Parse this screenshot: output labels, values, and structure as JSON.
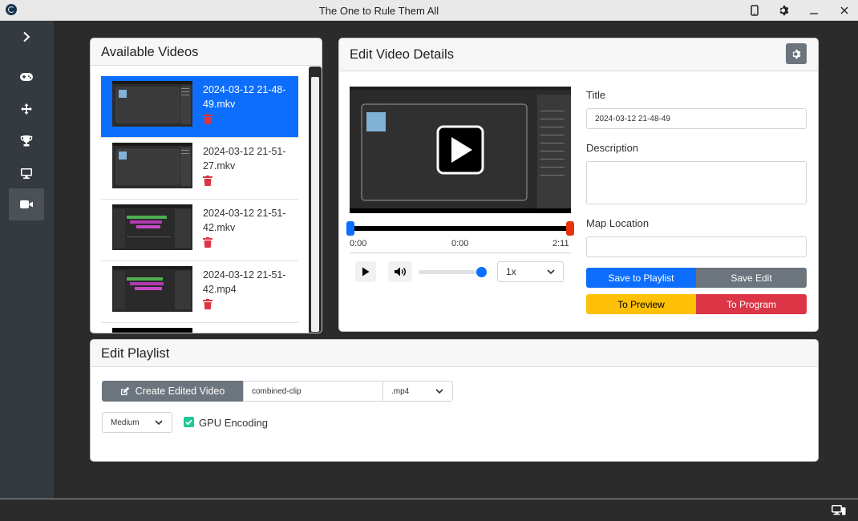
{
  "window": {
    "title": "The One to Rule Them All"
  },
  "sidebar": {
    "items": [
      {
        "name": "expand",
        "icon": "chevron-right-icon"
      },
      {
        "name": "gamepad",
        "icon": "gamepad-icon"
      },
      {
        "name": "move",
        "icon": "arrows-move-icon"
      },
      {
        "name": "trophy",
        "icon": "trophy-icon"
      },
      {
        "name": "monitor",
        "icon": "monitor-icon"
      },
      {
        "name": "video",
        "icon": "video-camera-icon",
        "active": true
      }
    ]
  },
  "available_videos": {
    "title": "Available Videos",
    "items": [
      {
        "name": "2024-03-12 21-48-49.mkv",
        "selected": true
      },
      {
        "name": "2024-03-12 21-51-27.mkv"
      },
      {
        "name": "2024-03-12 21-51-42.mkv"
      },
      {
        "name": "2024-03-12 21-51-42.mp4"
      }
    ]
  },
  "edit_details": {
    "title": "Edit Video Details",
    "player": {
      "start_time": "0:00",
      "current_time": "0:00",
      "end_time": "2:11",
      "speed": "1x",
      "volume": 1.0
    },
    "title_label": "Title",
    "title_value": "2024-03-12 21-48-49",
    "description_label": "Description",
    "description_value": "",
    "map_label": "Map Location",
    "map_value": "",
    "buttons": {
      "save_playlist": "Save to Playlist",
      "save_edit": "Save Edit",
      "to_preview": "To Preview",
      "to_program": "To Program"
    }
  },
  "edit_playlist": {
    "title": "Edit Playlist",
    "create_label": "Create Edited Video",
    "filename": "combined-clip",
    "format": ".mp4",
    "quality": "Medium",
    "gpu_label": "GPU Encoding",
    "gpu_checked": true
  },
  "colors": {
    "primary": "#0d6efd",
    "secondary": "#6c757d",
    "warning": "#ffc107",
    "danger": "#dc3545",
    "success": "#20c997"
  }
}
